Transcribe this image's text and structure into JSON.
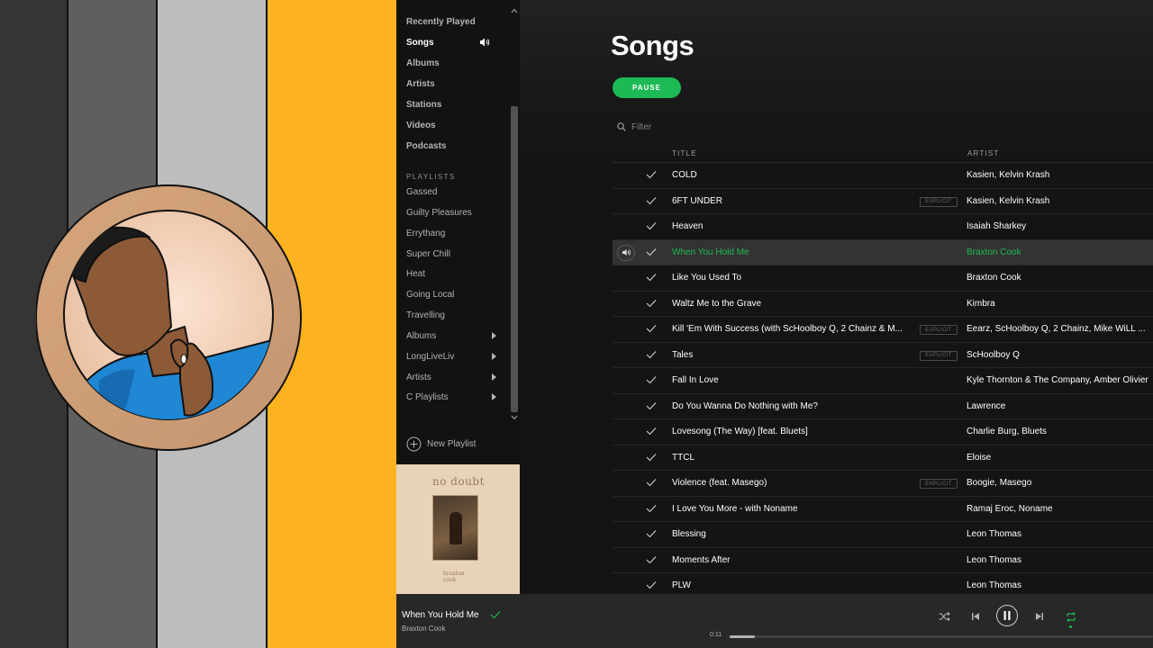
{
  "colors": {
    "accent": "#1db954",
    "sidebar_bg": "#121212",
    "main_bg": "#181818",
    "player_bg": "#282828"
  },
  "sidebar": {
    "nav": [
      {
        "label": "Recently Played",
        "active": false
      },
      {
        "label": "Songs",
        "active": true
      },
      {
        "label": "Albums",
        "active": false
      },
      {
        "label": "Artists",
        "active": false
      },
      {
        "label": "Stations",
        "active": false
      },
      {
        "label": "Videos",
        "active": false
      },
      {
        "label": "Podcasts",
        "active": false
      }
    ],
    "playlists_header": "PLAYLISTS",
    "playlists": [
      {
        "label": "Gassed",
        "folder": false
      },
      {
        "label": "Guilty Pleasures",
        "folder": false
      },
      {
        "label": "Errythang",
        "folder": false
      },
      {
        "label": "Super Chill",
        "folder": false
      },
      {
        "label": "Heat",
        "folder": false
      },
      {
        "label": "Going Local",
        "folder": false
      },
      {
        "label": "Travelling",
        "folder": false
      },
      {
        "label": "Albums",
        "folder": true
      },
      {
        "label": "LongLiveLiv",
        "folder": true
      },
      {
        "label": "Artists",
        "folder": true
      },
      {
        "label": "C Playlists",
        "folder": true
      }
    ],
    "new_playlist_label": "New Playlist",
    "cover": {
      "title": "no doubt",
      "artist_line1": "braxton",
      "artist_line2": "cook"
    }
  },
  "main": {
    "title": "Songs",
    "pause_label": "PAUSE",
    "filter_placeholder": "Filter",
    "columns": {
      "title": "TITLE",
      "artist": "ARTIST"
    },
    "explicit_label": "EXPLICIT",
    "songs": [
      {
        "title": "COLD",
        "artist": "Kasien, Kelvin Krash",
        "explicit": false,
        "playing": false
      },
      {
        "title": "6FT UNDER",
        "artist": "Kasien, Kelvin Krash",
        "explicit": true,
        "playing": false
      },
      {
        "title": "Heaven",
        "artist": "Isaiah Sharkey",
        "explicit": false,
        "playing": false
      },
      {
        "title": "When You Hold Me",
        "artist": "Braxton Cook",
        "explicit": false,
        "playing": true
      },
      {
        "title": "Like You Used To",
        "artist": "Braxton Cook",
        "explicit": false,
        "playing": false
      },
      {
        "title": "Waltz Me to the Grave",
        "artist": "Kimbra",
        "explicit": false,
        "playing": false
      },
      {
        "title": "Kill 'Em With Success (with ScHoolboy Q, 2 Chainz & M...",
        "artist": "Eearz, ScHoolboy Q, 2 Chainz, Mike WiLL ...",
        "explicit": true,
        "playing": false
      },
      {
        "title": "Tales",
        "artist": "ScHoolboy Q",
        "explicit": true,
        "playing": false
      },
      {
        "title": "Fall In Love",
        "artist": "Kyle Thornton & The Company, Amber Olivier",
        "explicit": false,
        "playing": false
      },
      {
        "title": "Do You Wanna Do Nothing with Me?",
        "artist": "Lawrence",
        "explicit": false,
        "playing": false
      },
      {
        "title": "Lovesong (The Way) [feat. Bluets]",
        "artist": "Charlie Burg, Bluets",
        "explicit": false,
        "playing": false
      },
      {
        "title": "TTCL",
        "artist": "Eloise",
        "explicit": false,
        "playing": false
      },
      {
        "title": "Violence (feat. Masego)",
        "artist": "Boogie, Masego",
        "explicit": true,
        "playing": false
      },
      {
        "title": "I Love You More - with Noname",
        "artist": "Ramaj Eroc, Noname",
        "explicit": false,
        "playing": false
      },
      {
        "title": "Blessing",
        "artist": "Leon Thomas",
        "explicit": false,
        "playing": false
      },
      {
        "title": "Moments After",
        "artist": "Leon Thomas",
        "explicit": false,
        "playing": false
      },
      {
        "title": "PLW",
        "artist": "Leon Thomas",
        "explicit": false,
        "playing": false
      }
    ]
  },
  "player": {
    "now_playing_title": "When You Hold Me",
    "now_playing_artist": "Braxton Cook",
    "elapsed": "0:11",
    "progress_fraction": 0.06,
    "repeat_on": true
  }
}
